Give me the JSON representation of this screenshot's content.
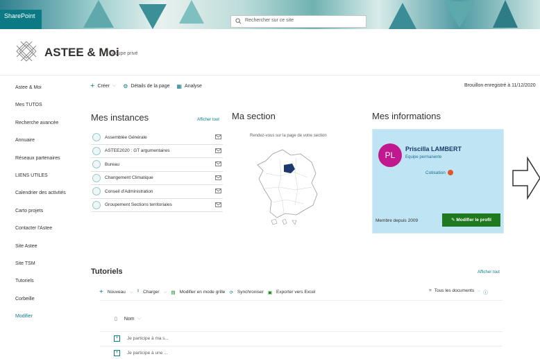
{
  "suite": {
    "brand": "SharePoint",
    "search_placeholder": "Rechercher sur ce site"
  },
  "site": {
    "title": "ASTEE & Moi",
    "subtitle": "Groupe privé"
  },
  "leftnav": {
    "items": [
      "Astee & Moi",
      "Mes TUTOS",
      "Recherche avancée",
      "Annuaire",
      "Réseaux partenaires",
      "LIENS UTILES",
      "Calendrier des activités",
      "Carto projets",
      "Contacter l'Astee",
      "Site Astee",
      "Site TSM",
      "Tutoriels",
      "Corbeille"
    ],
    "edit": "Modifier"
  },
  "command": {
    "create": "Créer",
    "details": "Détails de la page",
    "analysis": "Analyse",
    "draft_status": "Brouillon enregistré à 11/12/2020"
  },
  "instances": {
    "title": "Mes instances",
    "see_all": "Afficher tout",
    "items": [
      "Assemblée Générale",
      "ASTEE2020 : GT argumentaires",
      "Bureau",
      "Changement Climatique",
      "Conseil d'Administration",
      "Groupement Sections territoriales"
    ]
  },
  "section": {
    "title": "Ma section",
    "caption": "Rendez-vous sur la page de votre section"
  },
  "info": {
    "title": "Mes informations",
    "initials": "PL",
    "name": "Priscilla LAMBERT",
    "role": "Equipe permanente",
    "cotisation": "Cotisation",
    "member_since": "Membre depuis 2009",
    "edit_profile": "Modifier le profil"
  },
  "tutoriels": {
    "title": "Tutoriels",
    "see_all": "Afficher tout",
    "commands": {
      "new": "Nouveau",
      "upload": "Charger",
      "grid": "Modifier en mode grille",
      "sync": "Synchroniser",
      "excel": "Exporter vers Excel"
    },
    "filter": "Tous les documents",
    "column_name": "Nom",
    "rows": [
      "Je participe à ma s...",
      "Je participe à une ..."
    ]
  },
  "colors": {
    "accent": "#0b7a84",
    "card": "#bfe4f4",
    "avatar": "#c2188f",
    "button": "#1f7a1f"
  }
}
